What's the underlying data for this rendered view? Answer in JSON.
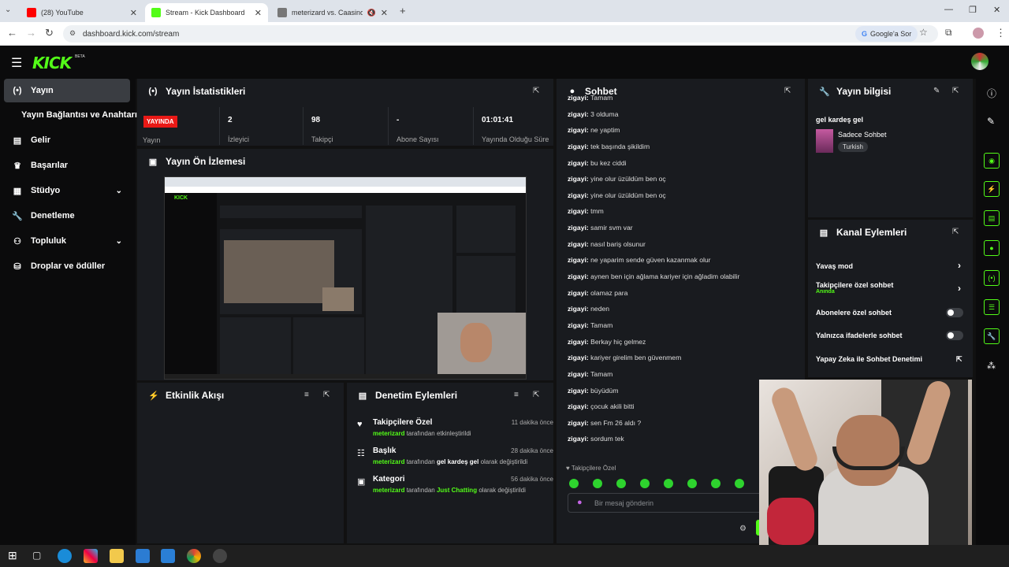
{
  "browser": {
    "tabs": [
      {
        "title": "(28) YouTube"
      },
      {
        "title": "Stream - Kick Dashboard"
      },
      {
        "title": "meterizard vs. Caasinova72"
      }
    ],
    "url": "dashboard.kick.com/stream",
    "google_btn": "Google'a Sor"
  },
  "kick": {
    "logo": "KICK",
    "beta": "BETA"
  },
  "sidebar": {
    "items": [
      {
        "label": "Yayın",
        "icon": "broadcast-icon"
      },
      {
        "label": "Yayın Bağlantısı ve Anahtarı",
        "icon": ""
      },
      {
        "label": "Gelir",
        "icon": "chart-icon"
      },
      {
        "label": "Başarılar",
        "icon": "trophy-icon"
      },
      {
        "label": "Stüdyo",
        "icon": "studio-icon"
      },
      {
        "label": "Denetleme",
        "icon": "wrench-icon"
      },
      {
        "label": "Topluluk",
        "icon": "people-icon"
      },
      {
        "label": "Droplar ve ödüller",
        "icon": "gift-icon"
      }
    ]
  },
  "stats": {
    "title": "Yayın İstatistikleri",
    "live_badge": "YAYINDA",
    "live_label": "Yayın",
    "items": [
      {
        "value": "2",
        "label": "İzleyici"
      },
      {
        "value": "98",
        "label": "Takipçi"
      },
      {
        "value": "-",
        "label": "Abone Sayısı"
      },
      {
        "value": "01:01:41",
        "label": "Yayında Olduğu Süre"
      }
    ]
  },
  "preview": {
    "title": "Yayın Ön İzlemesi"
  },
  "activity": {
    "title": "Etkinlik Akışı"
  },
  "moderation": {
    "title": "Denetim Eylemleri",
    "items": [
      {
        "title": "Takipçilere Özel",
        "user": "meterizard",
        "by": "tarafından",
        "value": "",
        "action": "etkinleştirildi",
        "time": "11 dakika önce"
      },
      {
        "title": "Başlık",
        "user": "meterizard",
        "by": "tarafından",
        "value": "gel kardeş gel",
        "action": "olarak değiştirildi",
        "time": "28 dakika önce"
      },
      {
        "title": "Kategori",
        "user": "meterizard",
        "by": "tarafından",
        "value": "Just Chatting",
        "action": "olarak değiştirildi",
        "time": "56 dakika önce"
      }
    ]
  },
  "chat": {
    "title": "Sohbet",
    "messages": [
      {
        "user": "zigayi",
        "text": "Tamam"
      },
      {
        "user": "zigayi",
        "text": "3 olduma"
      },
      {
        "user": "zigayi",
        "text": "ne yaptim"
      },
      {
        "user": "zigayi",
        "text": "tek başında şikildim"
      },
      {
        "user": "zigayi",
        "text": "bu kez ciddi"
      },
      {
        "user": "zigayi",
        "text": "yine olur üzüldüm ben oç"
      },
      {
        "user": "zigayi",
        "text": "yine olur üzüldüm ben oç"
      },
      {
        "user": "zigayi",
        "text": "tmm"
      },
      {
        "user": "zigayi",
        "text": "samir svm var"
      },
      {
        "user": "zigayi",
        "text": "nasıl bariş olsunur"
      },
      {
        "user": "zigayi",
        "text": "ne yaparim sende güven kazanmak olur"
      },
      {
        "user": "zigayi",
        "text": "aynen ben için ağlama kariyer için ağladim olabilir"
      },
      {
        "user": "zigayi",
        "text": "olamaz para"
      },
      {
        "user": "zigayi",
        "text": "neden"
      },
      {
        "user": "zigayi",
        "text": "Tamam"
      },
      {
        "user": "zigayi",
        "text": "Berkay hiç gelmez"
      },
      {
        "user": "zigayi",
        "text": "kariyer girelim ben güvenmem"
      },
      {
        "user": "zigayi",
        "text": "Tamam"
      },
      {
        "user": "zigayi",
        "text": "büyüdüm"
      },
      {
        "user": "zigayi",
        "text": "çocuk akili bitti"
      },
      {
        "user": "zigayi",
        "text": "sen Fm 26 aldı ?"
      },
      {
        "user": "zigayi",
        "text": "sordum tek"
      }
    ],
    "mode_label": "Takipçilere Özel",
    "input_placeholder": "Bir mesaj gönderin"
  },
  "stream_info": {
    "title": "Yayın bilgisi",
    "stream_title": "gel kardeş gel",
    "category": "Sadece Sohbet",
    "language": "Turkish"
  },
  "channel_actions": {
    "title": "Kanal Eylemleri",
    "items": [
      {
        "label": "Yavaş mod"
      },
      {
        "label": "Takipçilere özel sohbet",
        "sub": "Anında"
      },
      {
        "label": "Abonelere özel sohbet"
      },
      {
        "label": "Yalnızca ifadelerle sohbet"
      },
      {
        "label": "Yapay Zeka ile Sohbet Denetimi"
      }
    ]
  },
  "colors": {
    "accent": "#53fc18",
    "live": "#e91916",
    "panel": "#191b1f"
  }
}
